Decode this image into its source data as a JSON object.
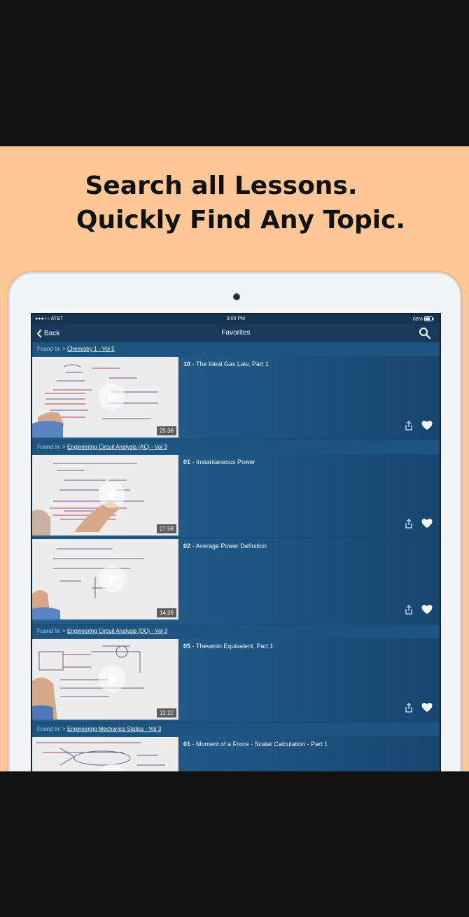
{
  "headline": {
    "line1": "Search all Lessons.",
    "line2": "Quickly Find Any Topic."
  },
  "status_bar": {
    "carrier": "●●●○○ AT&T",
    "time": "8:09 PM",
    "battery": "68%"
  },
  "nav": {
    "back_label": "Back",
    "title": "Favorites"
  },
  "found_prefix": "Found In:",
  "found_sep": ">",
  "groups": [
    {
      "course": "Chemistry 1 - Vol 5",
      "lessons": [
        {
          "num": "10",
          "sep": " - ",
          "name": "The Ideal Gas Law, Part 1",
          "duration": "25:38"
        }
      ]
    },
    {
      "course": "Engineering Circuit Analysis (AC) - Vol 3",
      "lessons": [
        {
          "num": "01",
          "sep": " - ",
          "name": "Instantaneous Power",
          "duration": "27:58"
        },
        {
          "num": "02",
          "sep": " - ",
          "name": "Average Power Definition",
          "duration": "14:39"
        }
      ]
    },
    {
      "course": "Engineering Circuit Analysis (DC) - Vol 3",
      "lessons": [
        {
          "num": "05",
          "sep": " - ",
          "name": "Thevenin Equivalent, Part 1",
          "duration": "12:22"
        }
      ]
    },
    {
      "course": "Engineering Mechanics Statics - Vol 3",
      "lessons": [
        {
          "num": "01",
          "sep": " - ",
          "name": "Moment of a Force - Scalar Calculation - Part 1",
          "duration": ""
        }
      ]
    }
  ],
  "icons": {
    "back": "chevron-left-icon",
    "search": "search-icon",
    "play": "play-icon",
    "share": "share-icon",
    "favorite": "heart-icon"
  },
  "colors": {
    "promo_background": "#fdc796",
    "screen_background": "#1b4e79",
    "nav_background": "#173a5c"
  }
}
